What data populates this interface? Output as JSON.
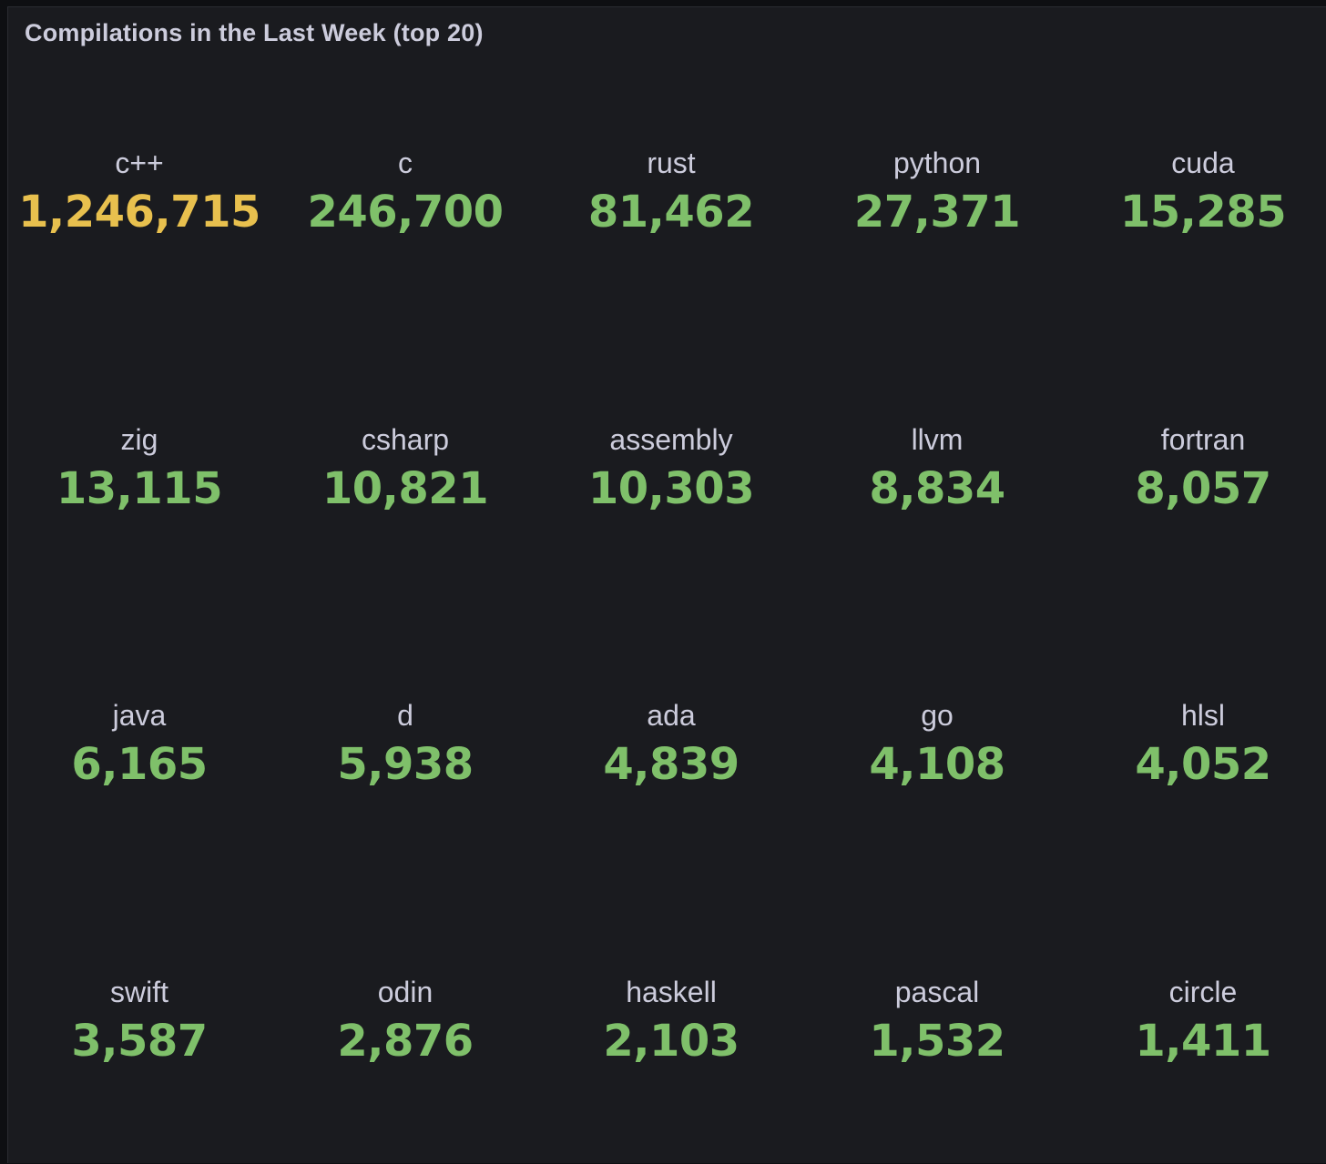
{
  "panel": {
    "title": "Compilations in the Last Week (top 20)"
  },
  "colors": {
    "warning": "#e8c04e",
    "ok": "#7fc06a",
    "label": "#ccccdc",
    "background": "#1a1b1f"
  },
  "stats": [
    {
      "label": "c++",
      "value": "1,246,715",
      "color": "#e8c04e"
    },
    {
      "label": "c",
      "value": "246,700",
      "color": "#7fc06a"
    },
    {
      "label": "rust",
      "value": "81,462",
      "color": "#7fc06a"
    },
    {
      "label": "python",
      "value": "27,371",
      "color": "#7fc06a"
    },
    {
      "label": "cuda",
      "value": "15,285",
      "color": "#7fc06a"
    },
    {
      "label": "zig",
      "value": "13,115",
      "color": "#7fc06a"
    },
    {
      "label": "csharp",
      "value": "10,821",
      "color": "#7fc06a"
    },
    {
      "label": "assembly",
      "value": "10,303",
      "color": "#7fc06a"
    },
    {
      "label": "llvm",
      "value": "8,834",
      "color": "#7fc06a"
    },
    {
      "label": "fortran",
      "value": "8,057",
      "color": "#7fc06a"
    },
    {
      "label": "java",
      "value": "6,165",
      "color": "#7fc06a"
    },
    {
      "label": "d",
      "value": "5,938",
      "color": "#7fc06a"
    },
    {
      "label": "ada",
      "value": "4,839",
      "color": "#7fc06a"
    },
    {
      "label": "go",
      "value": "4,108",
      "color": "#7fc06a"
    },
    {
      "label": "hlsl",
      "value": "4,052",
      "color": "#7fc06a"
    },
    {
      "label": "swift",
      "value": "3,587",
      "color": "#7fc06a"
    },
    {
      "label": "odin",
      "value": "2,876",
      "color": "#7fc06a"
    },
    {
      "label": "haskell",
      "value": "2,103",
      "color": "#7fc06a"
    },
    {
      "label": "pascal",
      "value": "1,532",
      "color": "#7fc06a"
    },
    {
      "label": "circle",
      "value": "1,411",
      "color": "#7fc06a"
    }
  ]
}
